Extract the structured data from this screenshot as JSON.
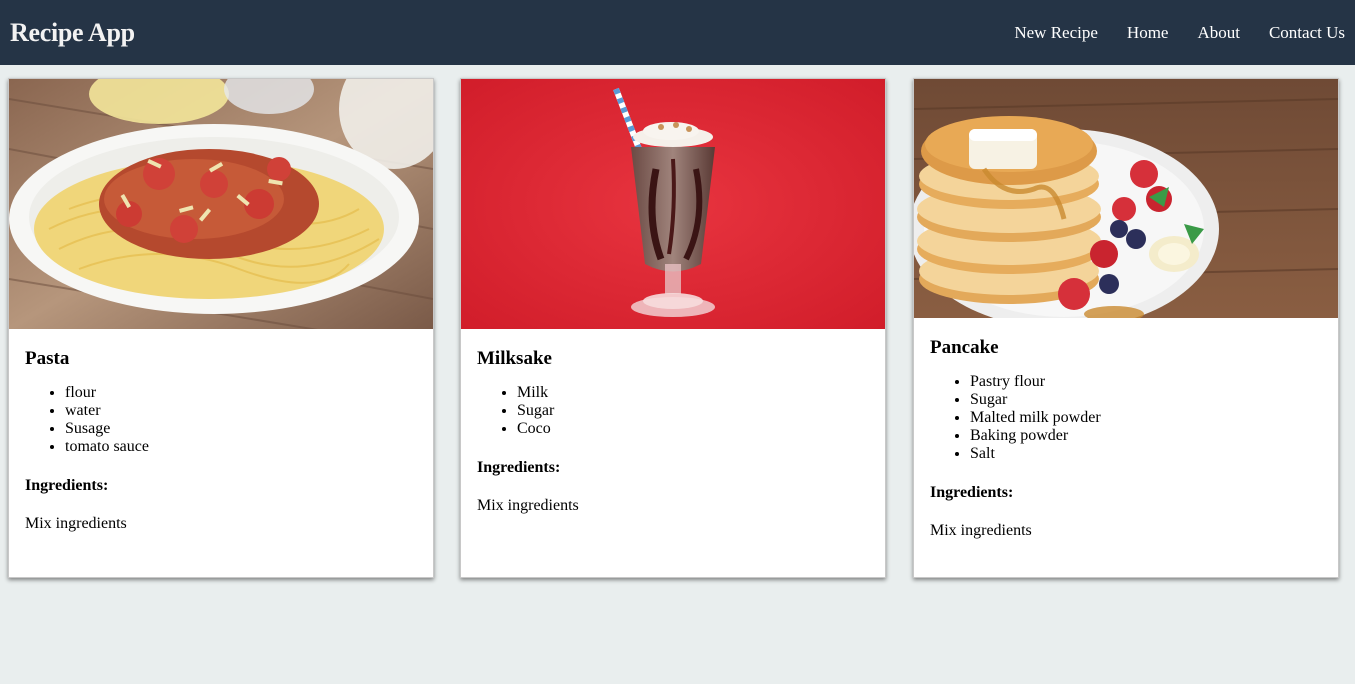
{
  "app": {
    "brand": "Recipe App"
  },
  "nav": {
    "items": [
      "New Recipe",
      "Home",
      "About",
      "Contact Us"
    ]
  },
  "recipes": [
    {
      "title": "Pasta",
      "image": "pasta-dish-image",
      "ingredients": [
        "flour",
        "water",
        "Susage",
        "tomato sauce"
      ],
      "ingredients_heading": "Ingredients:",
      "instructions": "Mix ingredients"
    },
    {
      "title": "Milksake",
      "image": "milkshake-glass-image",
      "ingredients": [
        "Milk",
        "Sugar",
        "Coco"
      ],
      "ingredients_heading": "Ingredients:",
      "instructions": "Mix ingredients"
    },
    {
      "title": "Pancake",
      "image": "pancake-stack-image",
      "ingredients": [
        "Pastry flour",
        "Sugar",
        "Malted milk powder",
        "Baking powder",
        "Salt"
      ],
      "ingredients_heading": "Ingredients:",
      "instructions": "Mix ingredients"
    }
  ],
  "colors": {
    "navbar": "#253446",
    "page_background": "#e9eeee",
    "card_background": "#ffffff"
  }
}
